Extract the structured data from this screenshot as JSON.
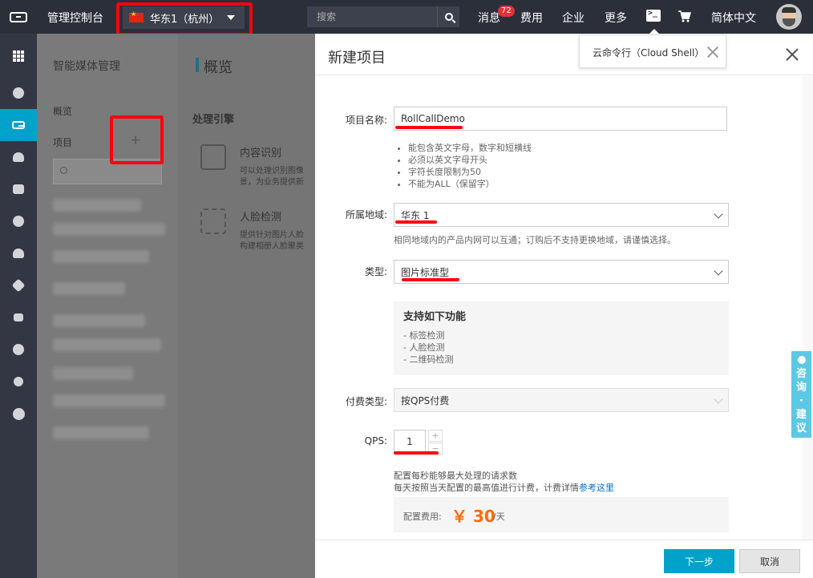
{
  "topbar": {
    "console_title": "管理控制台",
    "region": "华东1（杭州）",
    "search_placeholder": "搜索",
    "messages": "消息",
    "messages_badge": "72",
    "billing": "费用",
    "enterprise": "企业",
    "more": "更多",
    "language": "简体中文"
  },
  "sidebar": {
    "icons": [
      "apps-icon",
      "cloud-connect-icon",
      "media-logo-icon",
      "cloud-upload-icon",
      "database-icon",
      "cluster-icon",
      "cloud-icon",
      "network-icon",
      "topology-icon",
      "globe-icon",
      "bug-icon",
      "circle-icon"
    ]
  },
  "prodnav": {
    "title": "智能媒体管理",
    "overview": "概览",
    "projects": "项目"
  },
  "main": {
    "title": "概览",
    "section": "处理引擎",
    "features": [
      {
        "name": "内容识别",
        "desc_line1": "可以处理识别图像",
        "desc_line2": "景，为业务提供新"
      },
      {
        "name": "人脸检测",
        "desc_line1": "提供针对图片人脸",
        "desc_line2": "构建相册人脸聚类"
      }
    ]
  },
  "shell_popup": {
    "text": "云命令行（Cloud Shell）"
  },
  "modal": {
    "title": "新建项目",
    "project_name_label": "项目名称:",
    "project_name_value": "RollCallDemo",
    "hints": [
      "能包含英文字母，数字和短横线",
      "必须以英文字母开头",
      "字符长度限制为50",
      "不能为ALL（保留字）"
    ],
    "region_label": "所属地域:",
    "region_value": "华东 1",
    "region_note": "相同地域内的产品内网可以互通；订购后不支持更换地域，请谨慎选择。",
    "type_label": "类型:",
    "type_value": "图片标准型",
    "support_title": "支持如下功能",
    "support_items": [
      "- 标签检测",
      "- 人脸检测",
      "- 二维码检测"
    ],
    "billing_label": "付费类型:",
    "billing_value": "按QPS付费",
    "qps_label": "QPS:",
    "qps_value": "1",
    "qps_plus": "+",
    "qps_minus": "−",
    "qps_desc1": "配置每秒能够最大处理的请求数",
    "qps_desc2_prefix": "每天按照当天配置的最高值进行计费，计费详情",
    "qps_desc2_link": "参考这里",
    "cost_label": "配置费用:",
    "cost_value": "￥ 30",
    "cost_unit": "/天",
    "next_button": "下一步",
    "cancel_button": "取消"
  },
  "feedback": {
    "chars": [
      "咨",
      "询",
      "·",
      "建",
      "议"
    ]
  },
  "colors": {
    "accent": "#00a2ca",
    "highlight": "#ff0010",
    "price": "#ff6a00",
    "topbar": "#2b2f3a"
  }
}
